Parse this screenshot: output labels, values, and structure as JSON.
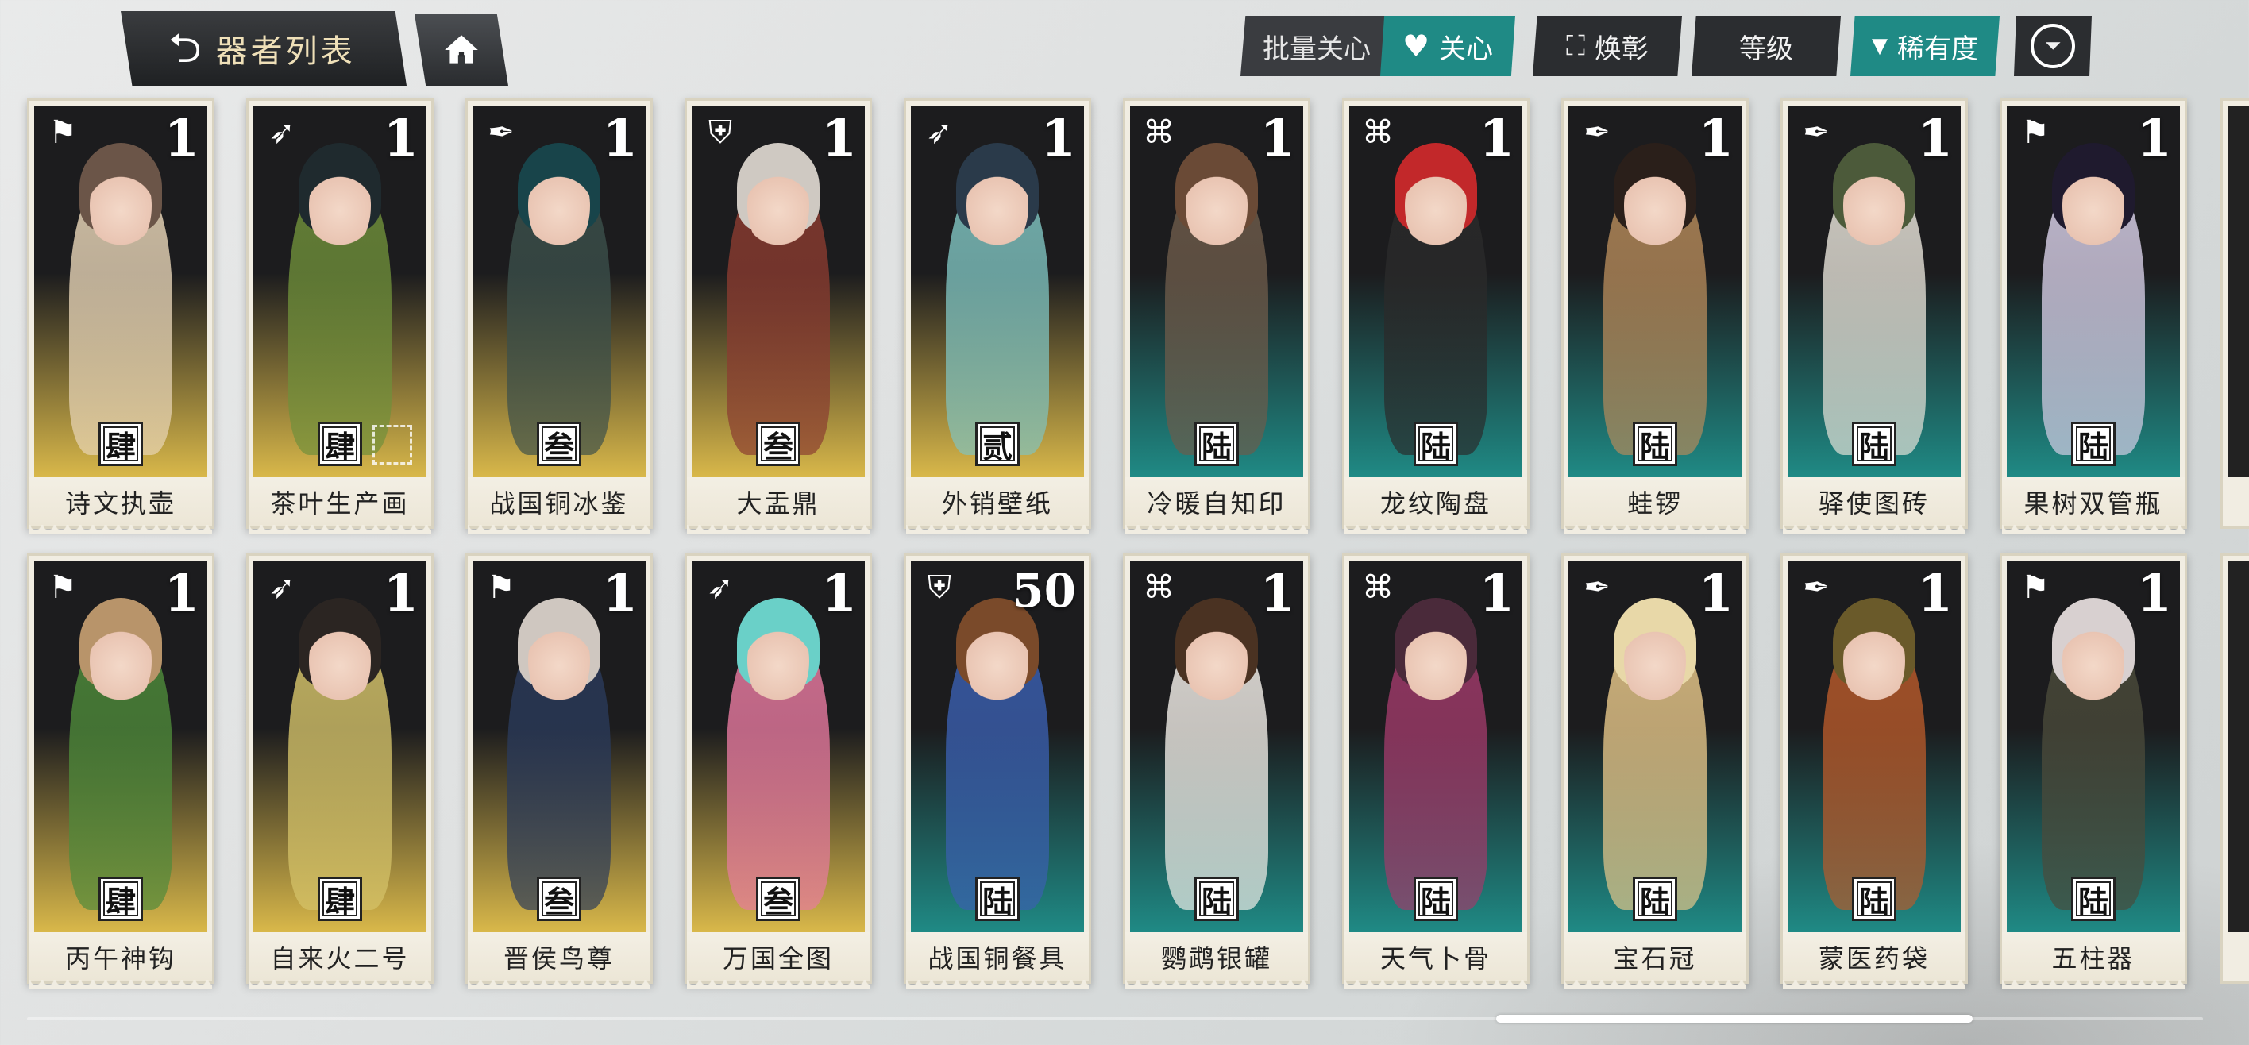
{
  "header": {
    "title": "器者列表",
    "back_icon": "back-arrow-icon",
    "home_icon": "home-icon"
  },
  "toolbar": {
    "batch_label": "批量关心",
    "batch_chevron": "«",
    "care_label": "关心",
    "glory_label": "焕彰",
    "level_label": "等级",
    "rarity_label": "稀有度",
    "filter_icon": "filter-icon"
  },
  "colors": {
    "accent_teal": "#1f8a85",
    "rarity_gold": "#d9b84a",
    "rarity_teal": "#1f8a85",
    "card_paper": "#f1ede2",
    "button_dark": "#2b2d30"
  },
  "cards": [
    {
      "name": "诗文执壶",
      "level": "1",
      "rarity": "肆",
      "type": "flag",
      "tier": "gold",
      "hair": "#6b5548",
      "cloth": "#e9d6b8"
    },
    {
      "name": "茶叶生产画",
      "level": "1",
      "rarity": "肆",
      "type": "bow",
      "tier": "gold",
      "hair": "#1f2a2e",
      "cloth": "#6f8f3a",
      "glory": true
    },
    {
      "name": "战国铜冰鉴",
      "level": "1",
      "rarity": "叁",
      "type": "quill",
      "tier": "gold",
      "hair": "#18444a",
      "cloth": "#3b4f4a"
    },
    {
      "name": "大盂鼎",
      "level": "1",
      "rarity": "叁",
      "type": "shield",
      "tier": "gold",
      "hair": "#cfc9c2",
      "cloth": "#8a3b30"
    },
    {
      "name": "外销壁纸",
      "level": "1",
      "rarity": "贰",
      "type": "bow",
      "tier": "gold",
      "hair": "#2a3a4a",
      "cloth": "#7fc3c0"
    },
    {
      "name": "冷暖自知印",
      "level": "1",
      "rarity": "陆",
      "type": "knot",
      "tier": "teal",
      "hair": "#6a4a36",
      "cloth": "#6d5b4a"
    },
    {
      "name": "龙纹陶盘",
      "level": "1",
      "rarity": "陆",
      "type": "knot",
      "tier": "teal",
      "hair": "#c2282a",
      "cloth": "#2a2a2a"
    },
    {
      "name": "蛙锣",
      "level": "1",
      "rarity": "陆",
      "type": "quill",
      "tier": "teal",
      "hair": "#2a1f1a",
      "cloth": "#b58a5a"
    },
    {
      "name": "驿使图砖",
      "level": "1",
      "rarity": "陆",
      "type": "quill",
      "tier": "teal",
      "hair": "#4c5a3a",
      "cloth": "#e8e4da"
    },
    {
      "name": "果树双管瓶",
      "level": "1",
      "rarity": "陆",
      "type": "flag",
      "tier": "teal",
      "hair": "#1f1a2e",
      "cloth": "#d8d0e8"
    },
    {
      "name": "丙午神钩",
      "level": "1",
      "rarity": "肆",
      "type": "flag",
      "tier": "gold",
      "hair": "#b8946a",
      "cloth": "#4e8a3a"
    },
    {
      "name": "自来火二号",
      "level": "1",
      "rarity": "肆",
      "type": "bow",
      "tier": "gold",
      "hair": "#2b2522",
      "cloth": "#d6c46a"
    },
    {
      "name": "晋侯鸟尊",
      "level": "1",
      "rarity": "叁",
      "type": "flag",
      "tier": "gold",
      "hair": "#cfc7c0",
      "cloth": "#2a3a5a"
    },
    {
      "name": "万国全图",
      "level": "1",
      "rarity": "叁",
      "type": "bow",
      "tier": "gold",
      "hair": "#6ad0c8",
      "cloth": "#e87aa0"
    },
    {
      "name": "战国铜餐具",
      "level": "50",
      "rarity": "陆",
      "type": "shield",
      "tier": "teal",
      "hair": "#7a4a2a",
      "cloth": "#3a5fb0"
    },
    {
      "name": "鹦鹉银罐",
      "level": "1",
      "rarity": "陆",
      "type": "knot",
      "tier": "teal",
      "hair": "#4a3222",
      "cloth": "#f4f0ea"
    },
    {
      "name": "天气卜骨",
      "level": "1",
      "rarity": "陆",
      "type": "knot",
      "tier": "teal",
      "hair": "#4a2a3a",
      "cloth": "#a03a6a"
    },
    {
      "name": "宝石冠",
      "level": "1",
      "rarity": "陆",
      "type": "quill",
      "tier": "teal",
      "hair": "#e8d8a8",
      "cloth": "#e8c88a"
    },
    {
      "name": "蒙医药袋",
      "level": "1",
      "rarity": "陆",
      "type": "quill",
      "tier": "teal",
      "hair": "#6a5a2a",
      "cloth": "#b85a2a"
    },
    {
      "name": "五柱器",
      "level": "1",
      "rarity": "陆",
      "type": "flag",
      "tier": "teal",
      "hair": "#d8d0d0",
      "cloth": "#4a4a3a"
    }
  ],
  "type_icons": {
    "flag": "flag-icon",
    "bow": "bow-icon",
    "quill": "quill-icon",
    "shield": "shield-icon",
    "knot": "knot-icon"
  },
  "type_glyphs": {
    "flag": "⚑",
    "bow": "➶",
    "quill": "✒",
    "shield": "⛨",
    "knot": "⌘"
  }
}
